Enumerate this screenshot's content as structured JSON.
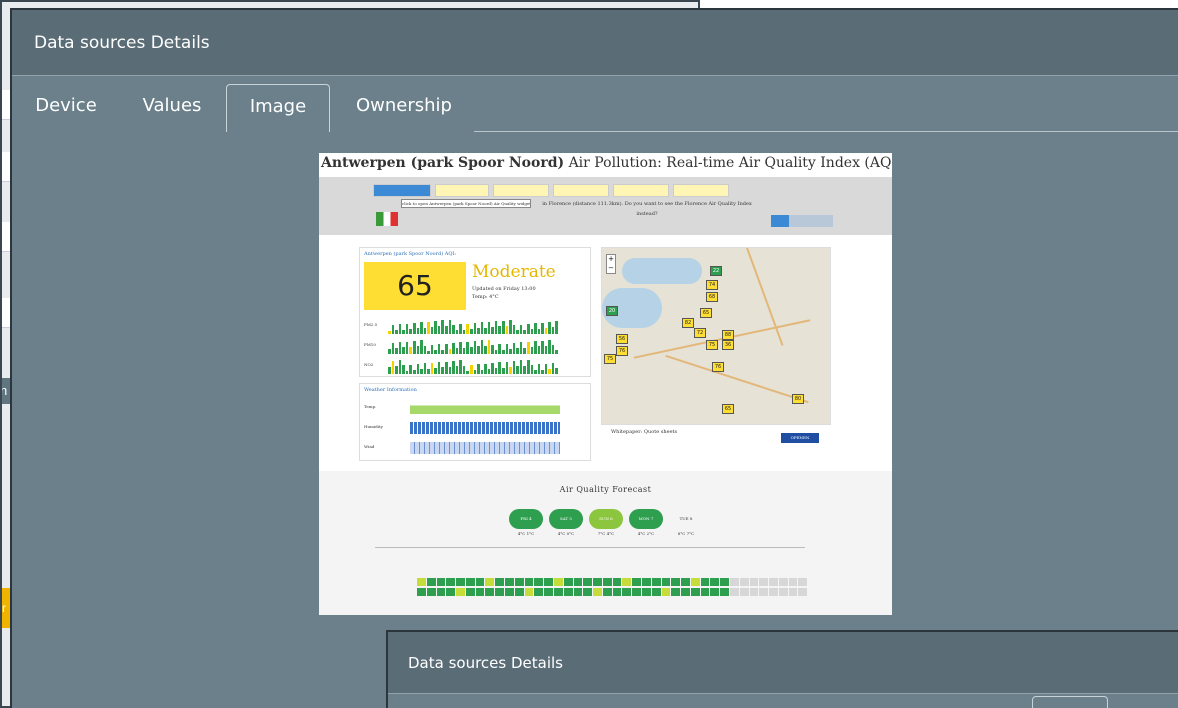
{
  "background": {
    "left_label_fragment": "h",
    "left_button_fragment": "r"
  },
  "dialog": {
    "title": "Data sources Details",
    "tabs": [
      {
        "label": "Device"
      },
      {
        "label": "Values"
      },
      {
        "label": "Image",
        "active": true
      },
      {
        "label": "Ownership"
      }
    ]
  },
  "image_content": {
    "title_bold": "Antwerpen (park Spoor Noord)",
    "title_rest": " Air Pollution: Real-time Air Quality Index (AQI)",
    "tooltip": "click to open Antwerpen (park Spoor Noord) Air Quality widget into...",
    "nav_text": "in Florence (distance 111.3km). Do you want to see the Florence Air Quality Index instead?",
    "widget_heading": "Antwerpen (park Spoor Noord) AQI:",
    "aqi_value": "65",
    "aqi_status": "Moderate",
    "updated": "Updated on Friday 13:00",
    "temp": "Temp: 4°C",
    "pollutants": [
      "PM2.5",
      "PM10",
      "NO2"
    ],
    "weather_heading": "Weather Information",
    "weather_rows": [
      "Temp.",
      "Humidity",
      "Wind"
    ],
    "map_markers": [
      "22",
      "74",
      "68",
      "20",
      "65",
      "82",
      "72",
      "88",
      "56",
      "75",
      "36",
      "76",
      "75",
      "76",
      "65",
      "80"
    ],
    "ad_text": "Whitepaper: Quote sheets",
    "ad_button": "OPENEN",
    "forecast_title": "Air Quality Forecast",
    "forecast_days": [
      {
        "label": "FRI 4",
        "temps": "4°C 1°C",
        "style": "dark"
      },
      {
        "label": "SAT 5",
        "temps": "4°C 0°C",
        "style": "dark"
      },
      {
        "label": "SUN 6",
        "temps": "7°C 4°C",
        "style": "light"
      },
      {
        "label": "MON 7",
        "temps": "4°C 2°C",
        "style": "dark"
      },
      {
        "label": "TUE 8",
        "temps": "8°C 7°C",
        "style": "empty"
      }
    ]
  },
  "dialog2": {
    "title": "Data sources Details"
  },
  "colors": {
    "dialog_bg": "#6b808b",
    "header_bg": "#5a6d77",
    "aqi_yellow": "#ffde33",
    "aqi_green": "#2e9e4f"
  }
}
